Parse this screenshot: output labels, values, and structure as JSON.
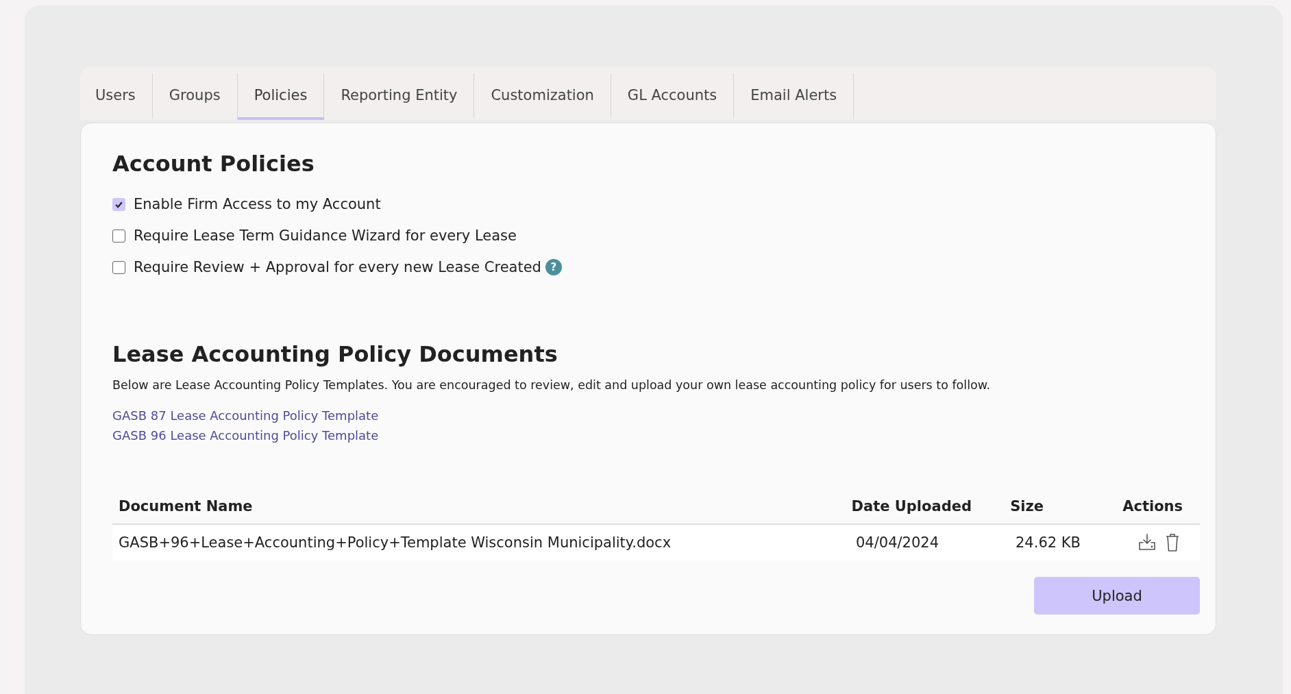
{
  "tabs": [
    {
      "label": "Users",
      "selected": false
    },
    {
      "label": "Groups",
      "selected": false
    },
    {
      "label": "Policies",
      "selected": true
    },
    {
      "label": "Reporting Entity",
      "selected": false
    },
    {
      "label": "Customization",
      "selected": false
    },
    {
      "label": "GL Accounts",
      "selected": false
    },
    {
      "label": "Email Alerts",
      "selected": false
    }
  ],
  "account_policies": {
    "title": "Account Policies",
    "options": [
      {
        "label": "Enable Firm Access to my Account",
        "checked": true
      },
      {
        "label": "Require Lease Term Guidance Wizard for every Lease",
        "checked": false
      },
      {
        "label": "Require Review + Approval for every new Lease Created",
        "checked": false,
        "help_symbol": "?"
      }
    ]
  },
  "documents": {
    "title": "Lease Accounting Policy Documents",
    "description": "Below are Lease Accounting Policy Templates. You are encouraged to review, edit and upload your own lease accounting policy for users to follow.",
    "links": [
      "GASB 87 Lease Accounting Policy Template",
      "GASB 96 Lease Accounting Policy Template"
    ],
    "table": {
      "columns": [
        "Document Name",
        "Date Uploaded",
        "Size",
        "Actions"
      ],
      "rows": [
        {
          "name": "GASB+96+Lease+Accounting+Policy+Template Wisconsin Municipality.docx",
          "date": "04/04/2024",
          "size": "24.62 KB"
        }
      ]
    },
    "upload_button": "Upload"
  }
}
